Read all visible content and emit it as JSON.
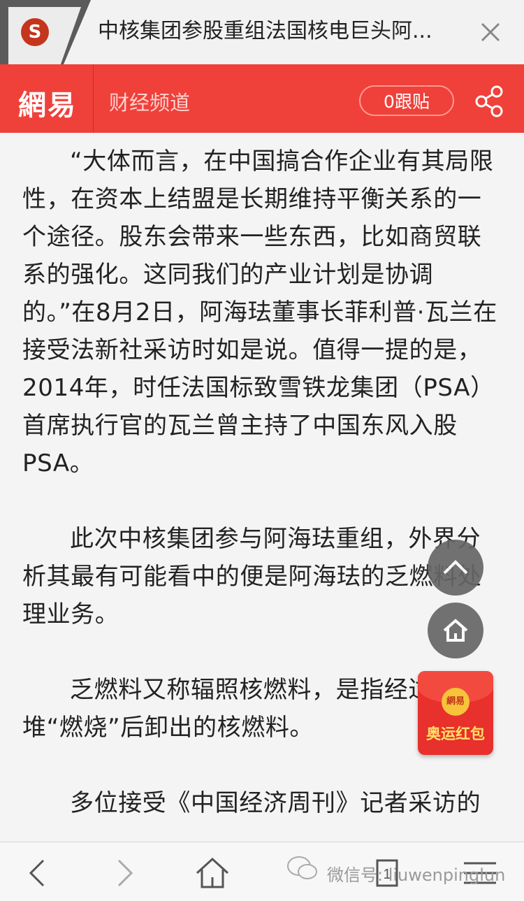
{
  "tab": {
    "title": "中核集团参股重组法国核电巨头阿...",
    "favicon_letter": "S",
    "favicon_icon": "sogou-icon",
    "close_icon": "close-icon"
  },
  "site": {
    "logo": "網易",
    "channel": "财经频道",
    "reply_label": "0跟贴",
    "share_icon": "share-icon",
    "brand_color": "#f0403a"
  },
  "article": {
    "paragraphs": [
      "“大体而言，在中国搞合作企业有其局限性，在资本上结盟是长期维持平衡关系的一个途径。股东会带来一些东西，比如商贸联系的强化。这同我们的产业计划是协调的。”在8月2日，阿海珐董事长菲利普·瓦兰在接受法新社采访时如是说。值得一提的是，2014年，时任法国标致雪铁龙集团（PSA）首席执行官的瓦兰曾主持了中国东风入股PSA。",
      "此次中核集团参与阿海珐重组，外界分析其最有可能看中的便是阿海珐的乏燃料处理业务。",
      "乏燃料又称辐照核燃料，是指经过反应堆“燃烧”后卸出的核燃料。",
      "多位接受《中国经济周刊》记者采访的"
    ]
  },
  "floating": {
    "scroll_top_icon": "chevron-up-icon",
    "home_icon": "home-icon",
    "red_packet": {
      "coin_text": "網易",
      "label": "奥运红包"
    }
  },
  "bottombar": {
    "back_icon": "chevron-left-icon",
    "forward_icon": "chevron-right-icon",
    "home_icon": "home-icon",
    "refresh_icon": "refresh-icon",
    "tabs_count": "1",
    "menu_icon": "menu-icon",
    "watermark": "微信号: liuwenpinglun"
  }
}
